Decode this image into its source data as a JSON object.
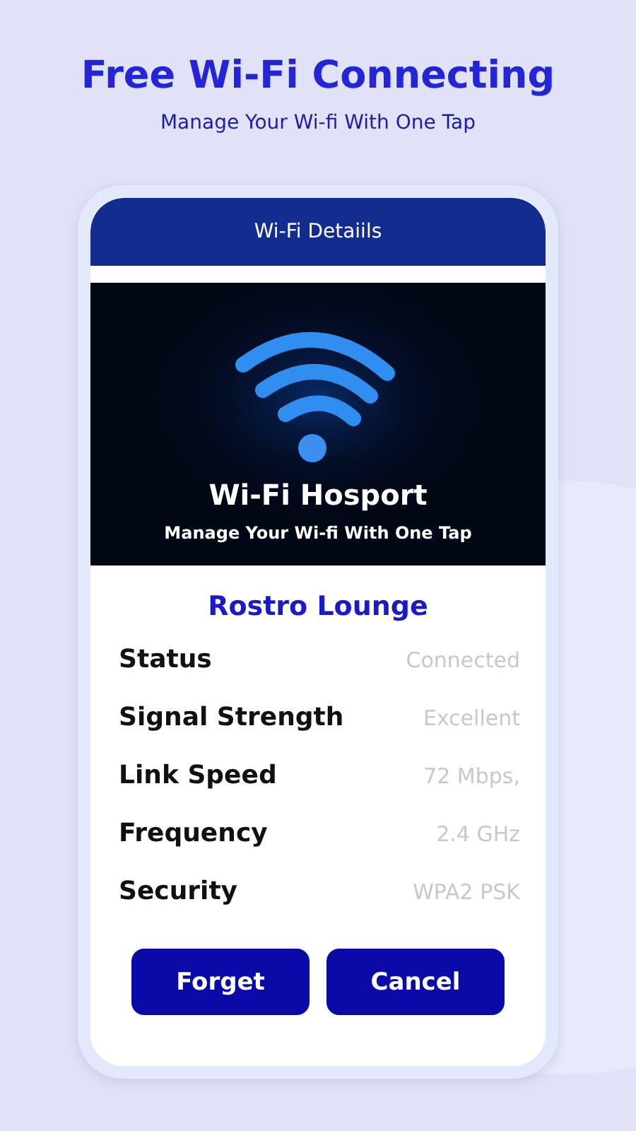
{
  "headline": "Free Wi-Fi Connecting",
  "subheadline": "Manage Your Wi-fi With One Tap",
  "screen_title": "Wi-Fi Detaiils",
  "banner": {
    "title": "Wi-Fi Hosport",
    "subtitle": "Manage Your Wi-fi With One Tap"
  },
  "network_name": "Rostro Lounge",
  "details": [
    {
      "label": "Status",
      "value": "Connected"
    },
    {
      "label": "Signal Strength",
      "value": "Excellent"
    },
    {
      "label": "Link Speed",
      "value": "72 Mbps,"
    },
    {
      "label": "Frequency",
      "value": "2.4 GHz"
    },
    {
      "label": "Security",
      "value": "WPA2 PSK"
    }
  ],
  "buttons": [
    "Forget",
    "Cancel"
  ]
}
